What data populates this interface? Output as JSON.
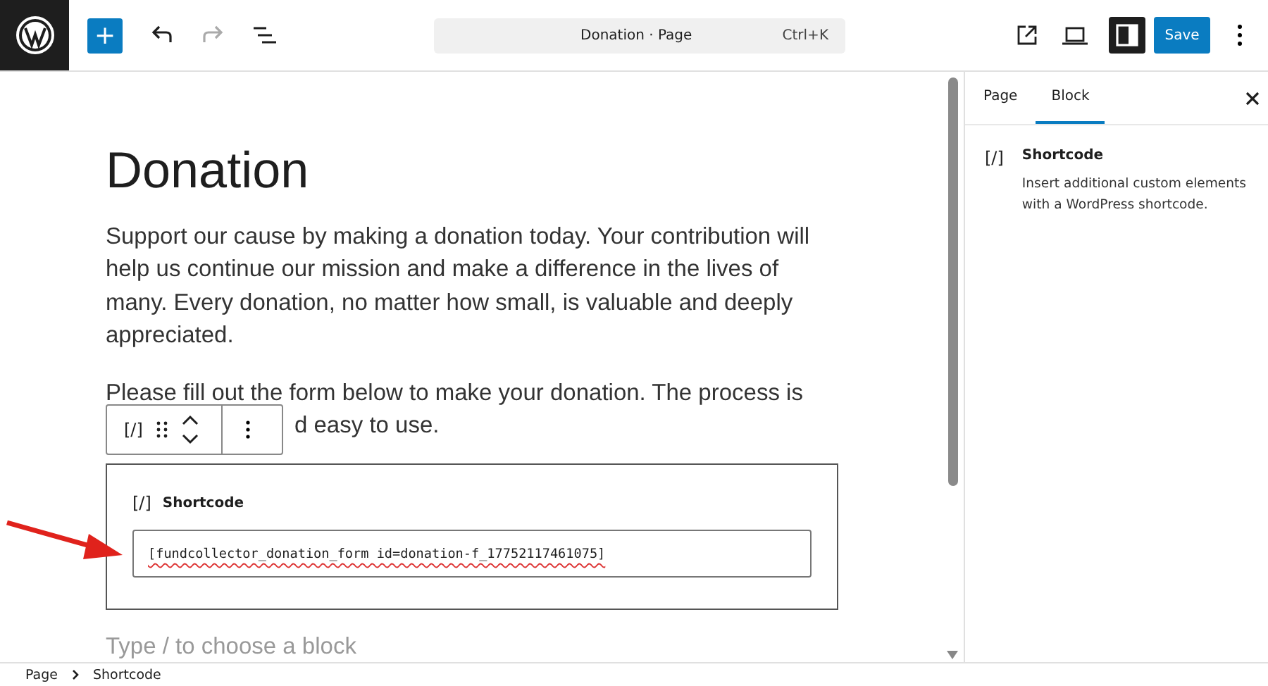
{
  "top_bar": {
    "add_button": "+",
    "command_bar": {
      "title": "Donation · Page",
      "shortcut": "Ctrl+K"
    },
    "save_button": "Save",
    "sidebar_toggle_on": true
  },
  "editor": {
    "title": "Donation",
    "paragraph": "Support our cause by making a donation today. Your contribution will help us continue our mission and make a difference in the lives of many. Every donation, no matter how small, is valuable and deeply appreciated.",
    "paragraph_2_line_1": "Please fill out the form below to make your donation. The process is",
    "paragraph_2_line_2_visible": "d easy to use.",
    "block_toolbar": {
      "block_icon": "[/]"
    },
    "shortcode_block": {
      "icon": "[/]",
      "label": "Shortcode",
      "value": "[fundcollector_donation_form id=donation-f_17752117461075]"
    },
    "placeholder": "Type / to choose a block"
  },
  "sidebar": {
    "tabs": [
      {
        "label": "Page",
        "selected": false
      },
      {
        "label": "Block",
        "selected": true
      }
    ],
    "block_card": {
      "icon": "[/]",
      "title": "Shortcode",
      "description": "Insert additional custom elements with a WordPress shortcode."
    }
  },
  "breadcrumb": [
    "Page",
    "Shortcode"
  ]
}
